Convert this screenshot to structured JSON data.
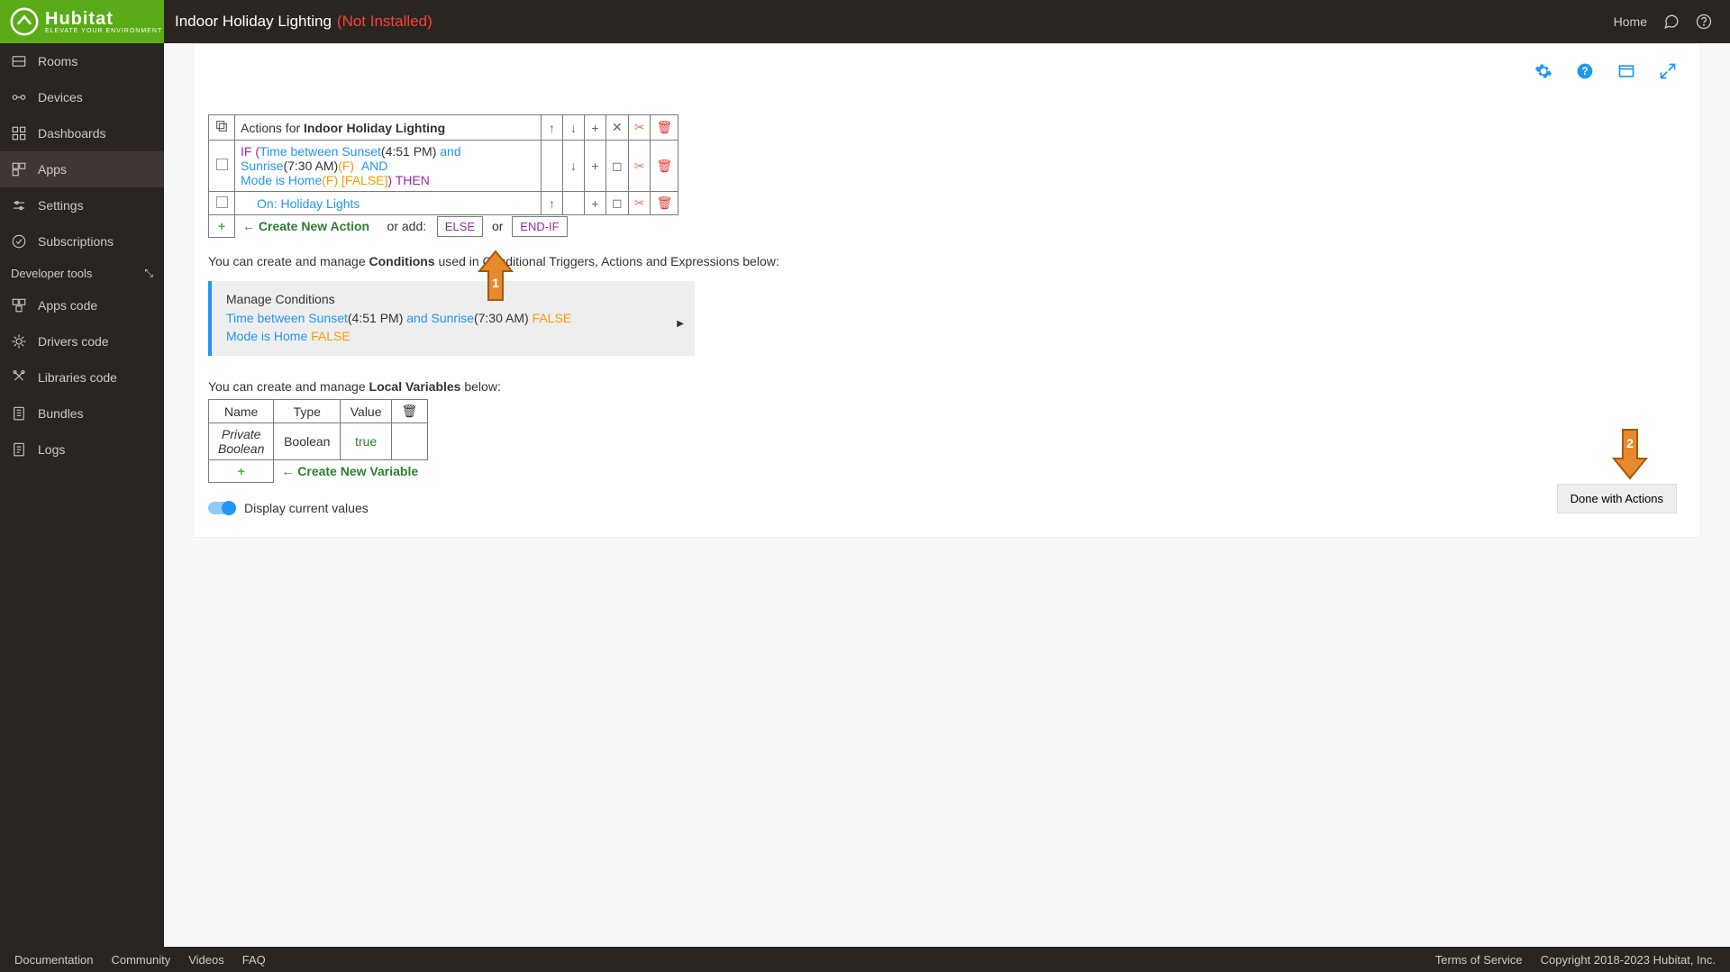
{
  "header": {
    "title": "Indoor Holiday Lighting",
    "status": "(Not Installed)",
    "home_link": "Home",
    "brand": "Hubitat",
    "brand_tag": "ELEVATE YOUR ENVIRONMENT"
  },
  "sidebar": {
    "items": [
      {
        "label": "Rooms"
      },
      {
        "label": "Devices"
      },
      {
        "label": "Dashboards"
      },
      {
        "label": "Apps"
      },
      {
        "label": "Settings"
      },
      {
        "label": "Subscriptions"
      }
    ],
    "dev_section": "Developer tools",
    "dev_items": [
      {
        "label": "Apps code"
      },
      {
        "label": "Drivers code"
      },
      {
        "label": "Libraries code"
      },
      {
        "label": "Bundles"
      },
      {
        "label": "Logs"
      }
    ]
  },
  "actions": {
    "header_prefix": "Actions for ",
    "header_name": "Indoor Holiday Lighting",
    "row1": {
      "if_kw": "IF",
      "cond1a": "Time between Sunset",
      "cond1a_time": "(4:51 PM)",
      "and_kw": "and",
      "cond1b": "Sunrise",
      "cond1b_time": "(7:30 AM)",
      "f1": "(F)",
      "and_big": "AND",
      "cond2": "Mode is Home",
      "f2": "(F)",
      "false_br": "[FALSE]",
      "then_kw": ") THEN"
    },
    "row2": {
      "on_label": "On:",
      "device": "Holiday Lights"
    },
    "create_action": "Create New Action",
    "or_add": "or add:",
    "else_btn": "ELSE",
    "or_txt": "or",
    "endif_btn": "END-IF"
  },
  "conditions_hint": {
    "pre": "You can create and manage ",
    "bold": "Conditions",
    "post": " used in Conditional Triggers, Actions and Expressions below:"
  },
  "conditions_box": {
    "title": "Manage Conditions",
    "line1_a": "Time between Sunset",
    "line1_atime": "(4:51 PM)",
    "line1_and": "and",
    "line1_b": "Sunrise",
    "line1_btime": "(7:30 AM)",
    "line1_false": "FALSE",
    "line2_a": "Mode is Home",
    "line2_false": "FALSE"
  },
  "vars_hint": {
    "pre": "You can create and manage ",
    "bold": "Local Variables",
    "post": " below:"
  },
  "vars_table": {
    "h_name": "Name",
    "h_type": "Type",
    "h_value": "Value",
    "r_name": "Private Boolean",
    "r_type": "Boolean",
    "r_value": "true",
    "create_var": "Create New Variable"
  },
  "toggle_label": "Display current values",
  "done_btn": "Done with Actions",
  "overlay": {
    "arrow1": "1",
    "arrow2": "2"
  },
  "footer": {
    "left": [
      "Documentation",
      "Community",
      "Videos",
      "FAQ"
    ],
    "right": [
      "Terms of Service",
      "Copyright 2018-2023 Hubitat, Inc."
    ]
  },
  "icons": {
    "up": "↑",
    "down": "↓",
    "plus": "+",
    "x": "✕",
    "cut": "✂",
    "trash": "🗑",
    "stop": "◻"
  }
}
